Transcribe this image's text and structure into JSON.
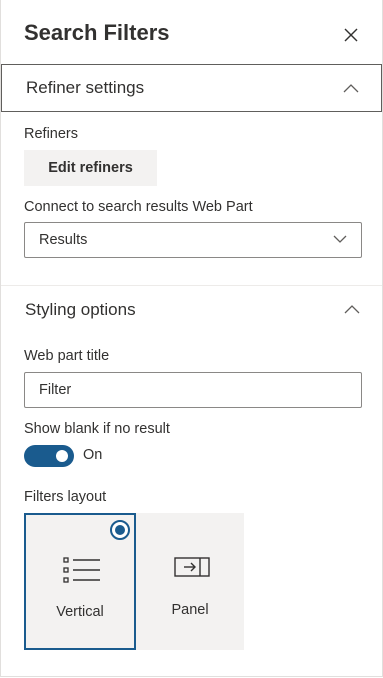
{
  "panel": {
    "title": "Search Filters"
  },
  "refiner_section": {
    "title": "Refiner settings",
    "refiners_label": "Refiners",
    "edit_button": "Edit refiners",
    "connect_label": "Connect to search results Web Part",
    "connect_value": "Results"
  },
  "styling_section": {
    "title": "Styling options",
    "webpart_title_label": "Web part title",
    "webpart_title_value": "Filter",
    "show_blank_label": "Show blank if no result",
    "show_blank_state": "On",
    "layout_label": "Filters layout",
    "layouts": [
      {
        "label": "Vertical",
        "icon": "list-icon",
        "selected": true
      },
      {
        "label": "Panel",
        "icon": "panel-icon",
        "selected": false
      }
    ]
  },
  "colors": {
    "accent": "#1a5b8e",
    "tile_bg": "#f3f2f1",
    "text": "#323130"
  }
}
